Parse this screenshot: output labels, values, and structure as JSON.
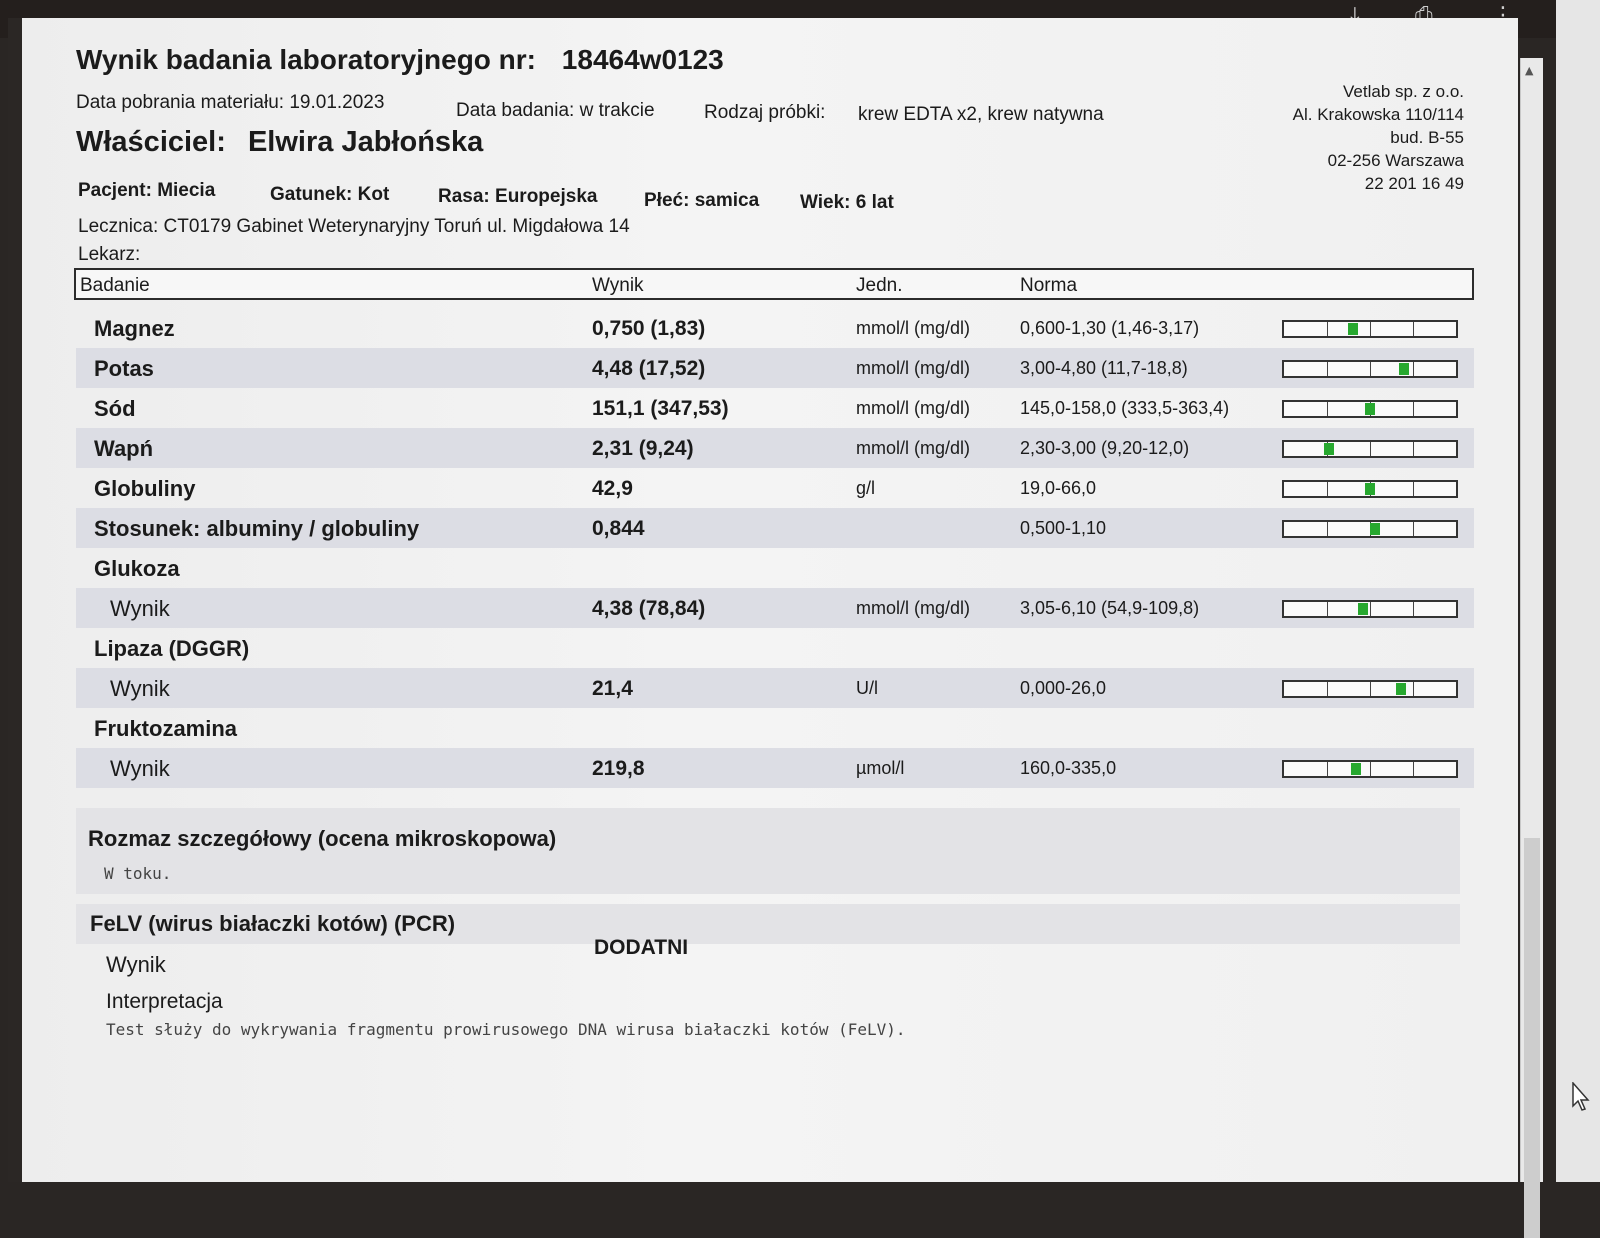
{
  "report": {
    "title": "Wynik badania laboratoryjnego nr:",
    "number": "18464w0123",
    "collection_date": "Data pobrania materiału: 19.01.2023",
    "test_date": "Data badania: w trakcie",
    "sample_label": "Rodzaj próbki:",
    "sample_value": "krew EDTA x2, krew natywna",
    "owner_label": "Właściciel:",
    "owner_name": "Elwira Jabłońska",
    "patient": "Pacjent: Miecia",
    "species": "Gatunek: Kot",
    "breed": "Rasa: Europejska",
    "sex": "Płeć: samica",
    "age": "Wiek: 6 lat",
    "clinic": "Lecznica: CT0179 Gabinet Weterynaryjny Toruń ul. Migdałowa 14",
    "doctor": "Lekarz:"
  },
  "lab": {
    "line1": "Vetlab sp. z o.o.",
    "line2": "Al. Krakowska 110/114",
    "line3": "bud. B-55",
    "line4": "02-256 Warszawa",
    "line5": "22 201 16 49"
  },
  "table": {
    "headers": {
      "test": "Badanie",
      "result": "Wynik",
      "unit": "Jedn.",
      "norm": "Norma"
    },
    "rows": [
      {
        "name": "Magnez",
        "value": "0,750 (1,83)",
        "unit": "mmol/l (mg/dl)",
        "norm": "0,600-1,30 (1,46-3,17)",
        "level": 0.4
      },
      {
        "name": "Potas",
        "value": "4,48 (17,52)",
        "unit": "mmol/l (mg/dl)",
        "norm": "3,00-4,80 (11,7-18,8)",
        "level": 0.7
      },
      {
        "name": "Sód",
        "value": "151,1 (347,53)",
        "unit": "mmol/l (mg/dl)",
        "norm": "145,0-158,0 (333,5-363,4)",
        "level": 0.5
      },
      {
        "name": "Wapń",
        "value": "2,31 (9,24)",
        "unit": "mmol/l (mg/dl)",
        "norm": "2,30-3,00 (9,20-12,0)",
        "level": 0.26
      },
      {
        "name": "Globuliny",
        "value": "42,9",
        "unit": "g/l",
        "norm": "19,0-66,0",
        "level": 0.5
      },
      {
        "name": "Stosunek: albuminy / globuliny",
        "value": "0,844",
        "unit": "",
        "norm": "0,500-1,10",
        "level": 0.53
      },
      {
        "name": "Glukoza"
      },
      {
        "sub": "Wynik",
        "value": "4,38 (78,84)",
        "unit": "mmol/l (mg/dl)",
        "norm": "3,05-6,10 (54,9-109,8)",
        "level": 0.46
      },
      {
        "name": "Lipaza (DGGR)"
      },
      {
        "sub": "Wynik",
        "value": "21,4",
        "unit": "U/l",
        "norm": "0,000-26,0",
        "level": 0.68
      },
      {
        "name": "Fruktozamina"
      },
      {
        "sub": "Wynik",
        "value": "219,8",
        "unit": "µmol/l",
        "norm": "160,0-335,0",
        "level": 0.42
      }
    ]
  },
  "smear": {
    "title": "Rozmaz szczegółowy (ocena mikroskopowa)",
    "status": "W toku."
  },
  "felv": {
    "title": "FeLV (wirus białaczki kotów) (PCR)",
    "result_label": "Wynik",
    "result_value": "DODATNI",
    "interp_label": "Interpretacja",
    "interp_text": "Test służy do wykrywania fragmentu prowirusowego DNA wirusa białaczki kotów (FeLV)."
  },
  "colors": {
    "in_range_marker": "#27a82f",
    "row_shade": "#dcdde4"
  },
  "icons": [
    "download-icon",
    "print-icon",
    "more-options-icon",
    "scroll-up-icon",
    "cursor-icon"
  ]
}
